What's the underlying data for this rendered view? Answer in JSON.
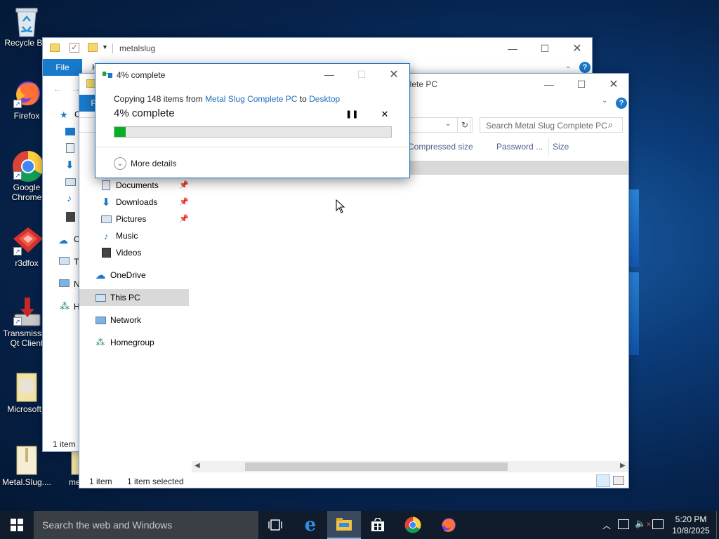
{
  "desktop": {
    "icons": [
      {
        "label": "Recycle Bin",
        "icon": "recycle-bin-icon"
      },
      {
        "label": "Firefox",
        "icon": "firefox-icon"
      },
      {
        "label": "Google Chrome",
        "icon": "chrome-icon"
      },
      {
        "label": "r3dfox",
        "icon": "r3dfox-icon"
      },
      {
        "label": "Transmission Qt Client",
        "icon": "transmission-icon"
      },
      {
        "label": "Microsoft_",
        "icon": "folder-icon"
      },
      {
        "label": "Metal.Slug....",
        "icon": "folder-icon"
      },
      {
        "label": "met",
        "icon": "folder-icon"
      }
    ]
  },
  "back_window": {
    "title": "metalslug",
    "file_tab": "File",
    "home_tab_partial": "H",
    "status": "1 item"
  },
  "front_window": {
    "title_partial": "plete PC",
    "file_tab_partial": "F",
    "search_placeholder": "Search Metal Slug Complete PC",
    "columns": [
      "Compressed size",
      "Password ...",
      "Size"
    ],
    "nav_partial": [
      "C",
      "T",
      "N",
      "H"
    ],
    "nav": [
      {
        "label": "Documents",
        "icon": "documents-icon",
        "pinned": true
      },
      {
        "label": "Downloads",
        "icon": "downloads-icon",
        "pinned": true
      },
      {
        "label": "Pictures",
        "icon": "pictures-icon",
        "pinned": true
      },
      {
        "label": "Music",
        "icon": "music-icon",
        "pinned": false
      },
      {
        "label": "Videos",
        "icon": "videos-icon",
        "pinned": false
      },
      {
        "label": "OneDrive",
        "icon": "onedrive-icon",
        "pinned": false
      },
      {
        "label": "This PC",
        "icon": "this-pc-icon",
        "pinned": false,
        "selected": true
      },
      {
        "label": "Network",
        "icon": "network-icon",
        "pinned": false
      },
      {
        "label": "Homegroup",
        "icon": "homegroup-icon",
        "pinned": false
      }
    ],
    "status_count": "1 item",
    "status_selected": "1 item selected"
  },
  "copy_dialog": {
    "title": "4% complete",
    "copy_prefix": "Copying 148 items from ",
    "source": "Metal Slug Complete PC",
    "to_word": " to ",
    "destination": "Desktop",
    "heading": "4% complete",
    "progress_percent": 4,
    "more_details": "More details"
  },
  "taskbar": {
    "search_placeholder": "Search the web and Windows",
    "time": "5:20 PM",
    "date": "10/8/2025",
    "pinned": [
      "task-view-icon",
      "edge-icon",
      "file-explorer-icon",
      "store-icon",
      "chrome-icon",
      "firefox-icon"
    ]
  },
  "colors": {
    "accent": "#1979ca",
    "progress": "#06b025",
    "taskbar": "#101c2b"
  }
}
